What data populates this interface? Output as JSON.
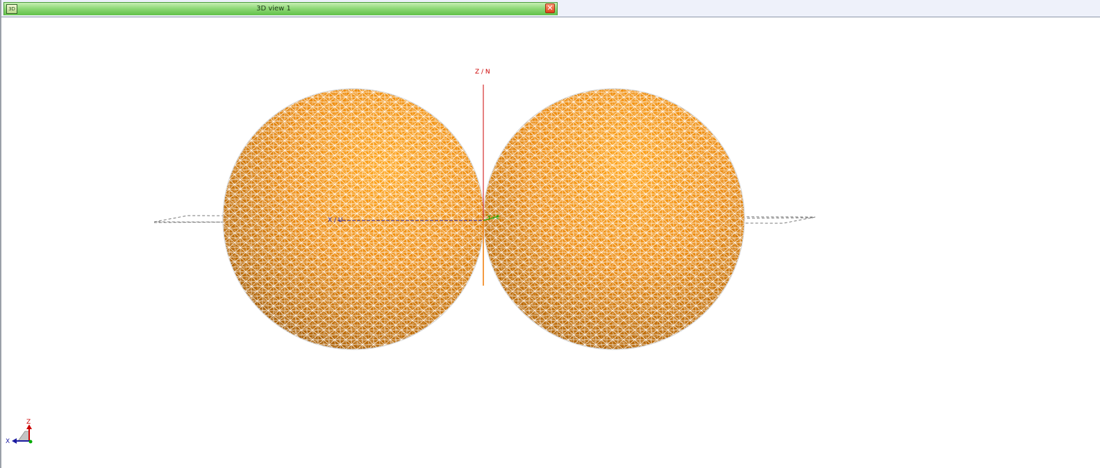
{
  "window": {
    "tab_title": "3D view 1",
    "tab_icon_label": "3D",
    "close_glyph": "✕"
  },
  "scene": {
    "axis_label_z": "Z / N",
    "axis_label_x": "X / U",
    "axis_label_y": "Y / E",
    "object_color": "#f0940f",
    "mesh_color": "#ffffff"
  },
  "triad": {
    "z_label": "Z",
    "x_label": "X"
  }
}
